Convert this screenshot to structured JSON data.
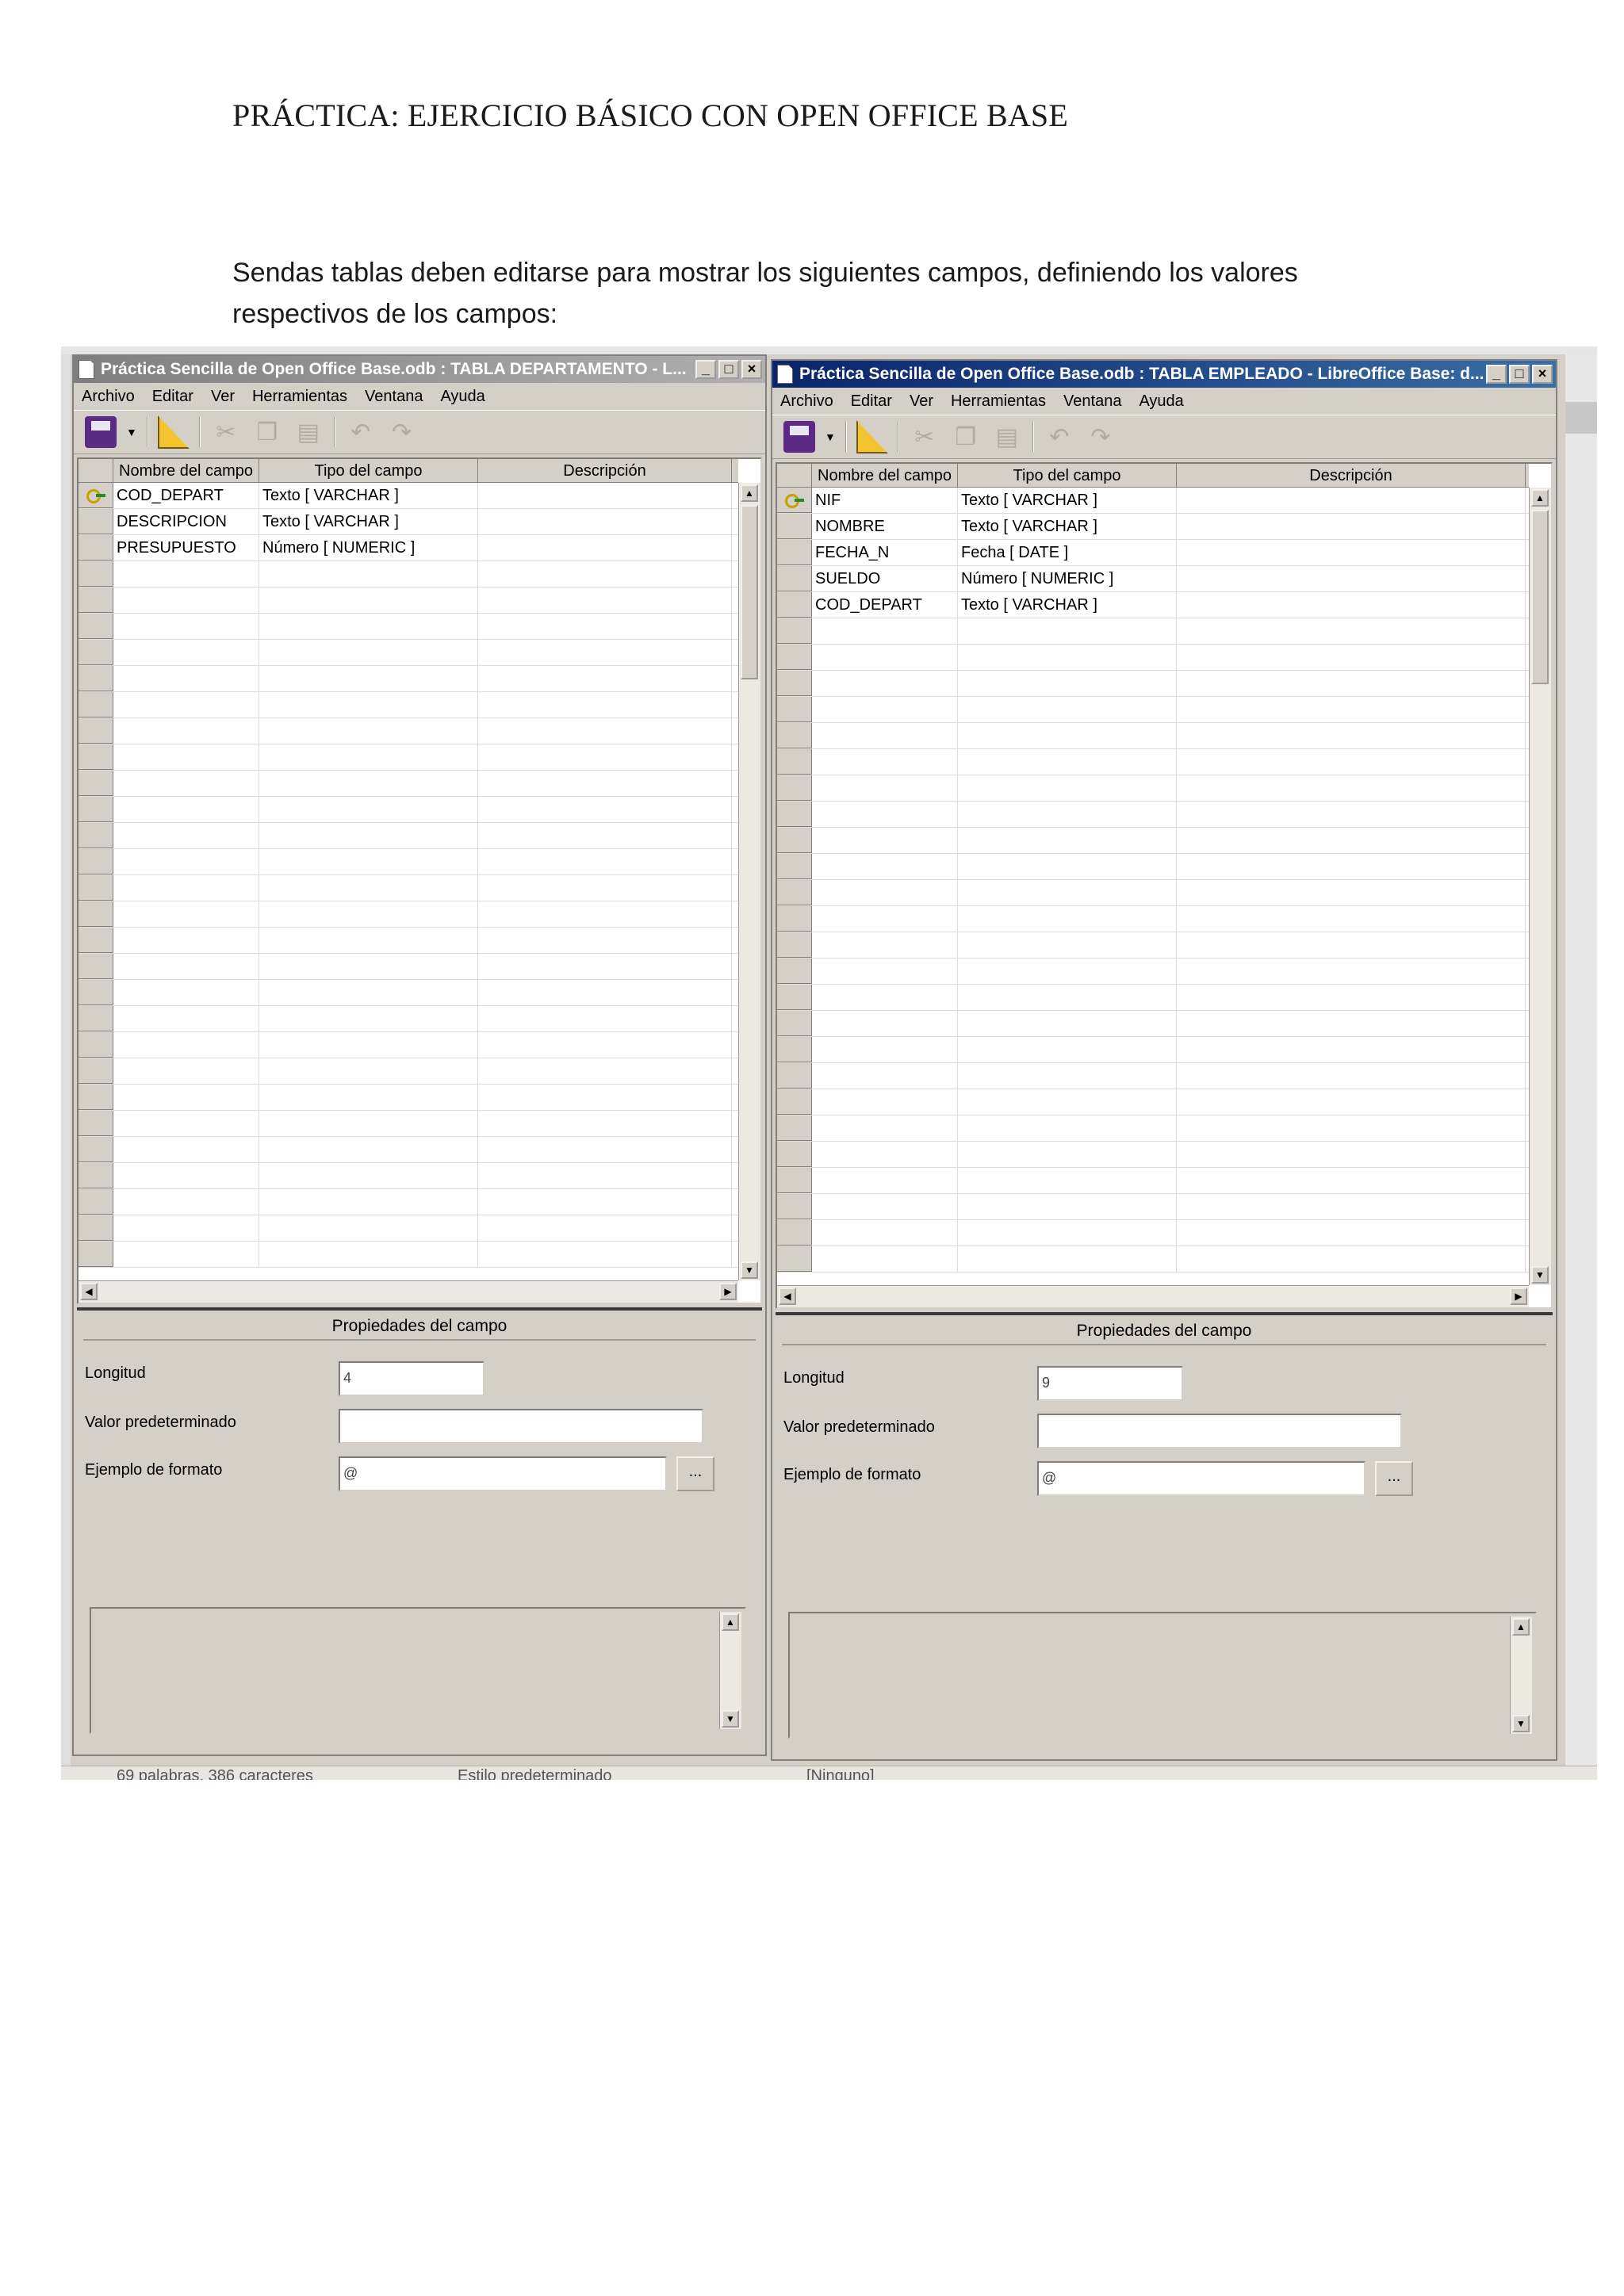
{
  "document": {
    "title": "PRÁCTICA: EJERCICIO BÁSICO CON OPEN OFFICE BASE",
    "intro": "Sendas tablas deben editarse para mostrar los siguientes campos, definiendo los valores respectivos de los campos:"
  },
  "menu": [
    "Archivo",
    "Editar",
    "Ver",
    "Herramientas",
    "Ventana",
    "Ayuda"
  ],
  "columns": [
    "Nombre del campo",
    "Tipo del campo",
    "Descripción"
  ],
  "properties": {
    "title": "Propiedades del campo",
    "length_label": "Longitud",
    "default_label": "Valor predeterminado",
    "format_label": "Ejemplo de formato",
    "dots": "..."
  },
  "windows": {
    "left": {
      "title": "Práctica Sencilla de Open Office Base.odb : TABLA DEPARTAMENTO - L...",
      "fields": [
        {
          "name": "COD_DEPART",
          "type": "Texto [ VARCHAR ]"
        },
        {
          "name": "DESCRIPCION",
          "type": "Texto [ VARCHAR ]"
        },
        {
          "name": "PRESUPUESTO",
          "type": "Número [ NUMERIC ]"
        }
      ],
      "length": "4",
      "default_value": "",
      "format_example": "@"
    },
    "right": {
      "title": "Práctica Sencilla de Open Office Base.odb : TABLA EMPLEADO - LibreOffice Base: d...",
      "fields": [
        {
          "name": "NIF",
          "type": "Texto [ VARCHAR ]"
        },
        {
          "name": "NOMBRE",
          "type": "Texto [ VARCHAR ]"
        },
        {
          "name": "FECHA_N",
          "type": "Fecha [ DATE ]"
        },
        {
          "name": "SUELDO",
          "type": "Número [ NUMERIC ]"
        },
        {
          "name": "COD_DEPART",
          "type": "Texto [ VARCHAR ]"
        }
      ],
      "length": "9",
      "default_value": "",
      "format_example": "@"
    }
  },
  "statusbar": {
    "words": "69 palabras, 386 caracteres",
    "style": "Estilo predeterminado",
    "lang": "[Ninguno]"
  },
  "colors": {
    "active_title": "#0a246a",
    "inactive_title": "#7f7f7f",
    "window_bg": "#d4d0c8"
  }
}
